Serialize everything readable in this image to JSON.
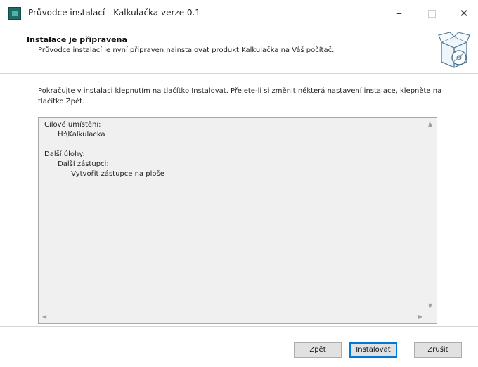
{
  "window": {
    "title": "Průvodce instalací - Kalkulačka verze 0.1",
    "minimize_glyph": "–",
    "close_glyph": "✕",
    "app_icon": "setup-app-icon"
  },
  "header": {
    "title": "Instalace je připravena",
    "subtitle": "Průvodce instalací je nyní připraven nainstalovat produkt Kalkulačka na Váš počítač.",
    "graphic_icon": "installer-box-disc-icon"
  },
  "body": {
    "instruction": "Pokračujte v instalaci klepnutím na tlačítko Instalovat. Přejete-li si změnit některá nastavení instalace, klepněte na tlačítko Zpět."
  },
  "summary": {
    "lines": [
      "Cílové umístění:",
      "      H:\\Kalkulacka",
      "",
      "Další úlohy:",
      "      Další zástupci:",
      "            Vytvořit zástupce na ploše"
    ]
  },
  "scrollbars": {
    "up": "▲",
    "down": "▼",
    "left": "◀",
    "right": "▶"
  },
  "buttons": {
    "back": "Zpět",
    "install": "Instalovat",
    "cancel": "Zrušit"
  },
  "colors": {
    "accent": "#0078d7",
    "app_icon": "#1f6b66",
    "button_face": "#e1e1e1",
    "memo_background": "#f0f0f0"
  }
}
